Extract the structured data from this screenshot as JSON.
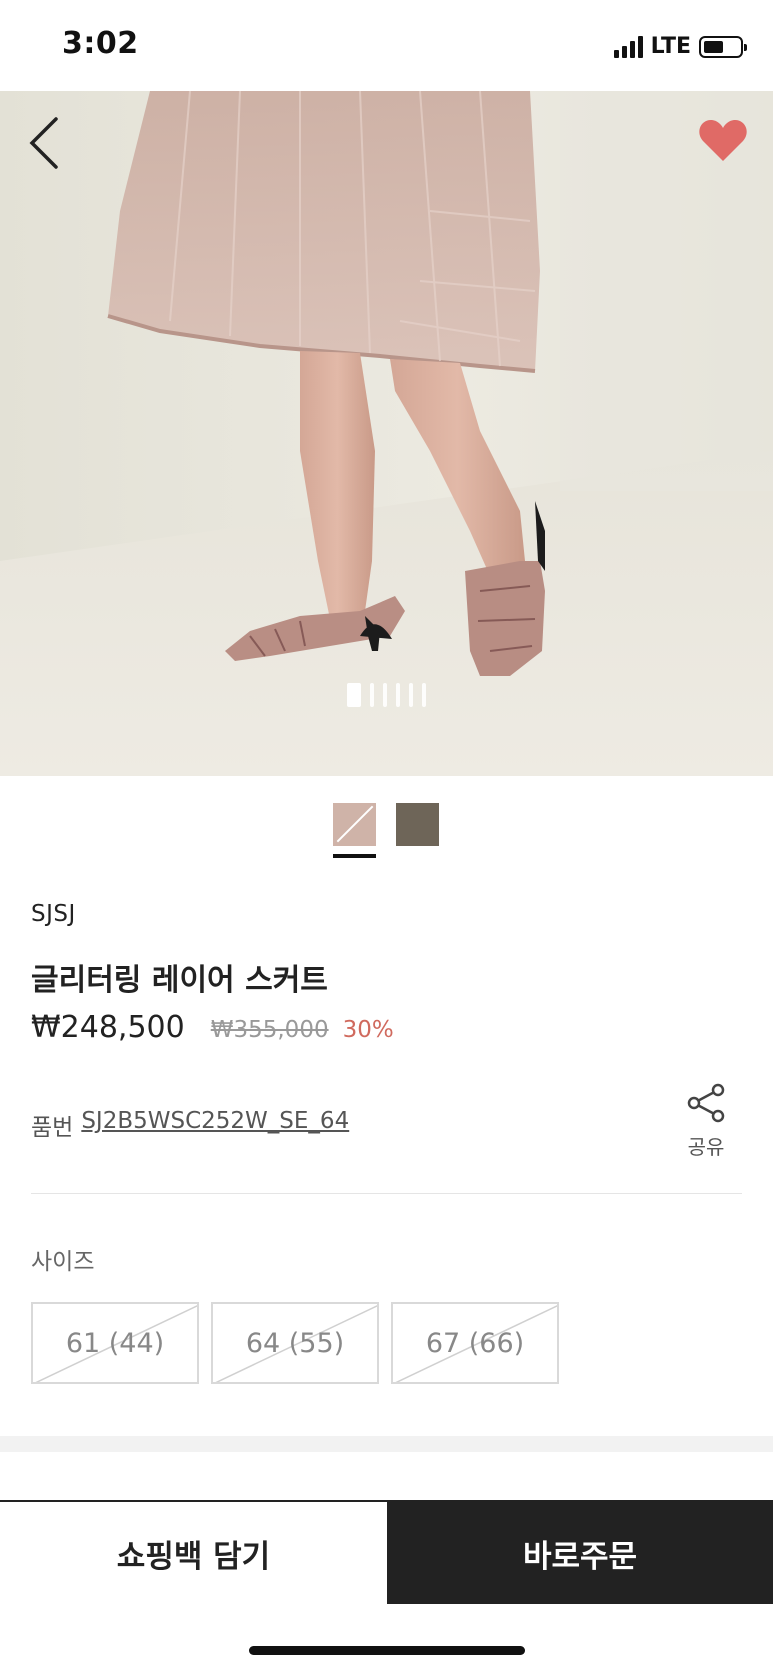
{
  "status_bar": {
    "time": "3:02",
    "network": "LTE",
    "battery_level": 0.55
  },
  "hero": {
    "image_count": 6,
    "active_index": 0,
    "back_icon": "chevron-left-icon",
    "favorite_icon": "heart-icon",
    "favorite_color": "#e06a66",
    "favorited": true
  },
  "color_options": [
    {
      "name": "pink",
      "swatch": "#cfb3a8",
      "selected": true,
      "sold_out": true
    },
    {
      "name": "brown",
      "swatch": "#6e6558",
      "selected": false,
      "sold_out": false
    }
  ],
  "product": {
    "brand": "SJSJ",
    "title": "글리터링 레이어 스커트",
    "price": "₩248,500",
    "original_price": "₩355,000",
    "discount": "30%",
    "sku_label": "품번",
    "sku": "SJ2B5WSC252W_SE_64"
  },
  "share": {
    "label": "공유",
    "icon": "share-icon"
  },
  "size": {
    "label": "사이즈",
    "options": [
      {
        "label": "61 (44)",
        "sold_out": true
      },
      {
        "label": "64 (55)",
        "sold_out": true
      },
      {
        "label": "67 (66)",
        "sold_out": true
      }
    ]
  },
  "actions": {
    "add_to_bag": "쇼핑백 담기",
    "buy_now": "바로주문"
  },
  "colors": {
    "discount": "#d06a5e",
    "buy_button": "#222222"
  }
}
